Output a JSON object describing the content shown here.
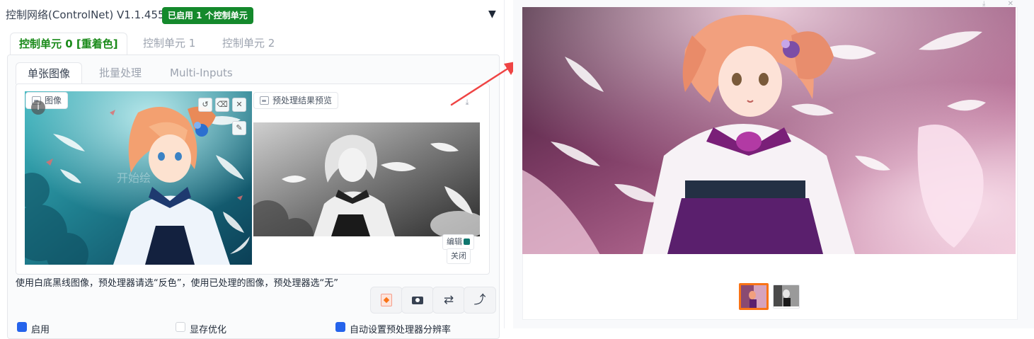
{
  "header": {
    "title": "控制网络(ControlNet) V1.1.455",
    "enabled_badge": "已启用 1 个控制单元",
    "collapse_icon": "triangle-down-icon"
  },
  "unit_tabs": [
    {
      "label": "控制单元 0 [重着色]",
      "active": true
    },
    {
      "label": "控制单元 1",
      "active": false
    },
    {
      "label": "控制单元 2",
      "active": false
    }
  ],
  "image_tabs": [
    {
      "label": "单张图像",
      "active": true
    },
    {
      "label": "批量处理",
      "active": false
    },
    {
      "label": "Multi-Inputs",
      "active": false
    }
  ],
  "image_panel": {
    "input_label": "图像",
    "watermark_text": "开始绘",
    "preview_label": "预处理结果预览",
    "edit_button": "编辑",
    "close_button": "关闭",
    "input_tools": [
      "undo-icon",
      "eraser-icon",
      "close-icon",
      "brush-icon"
    ],
    "download_icon": "download-icon"
  },
  "hint": "使用白底黑线图像，预处理器请选“反色”，使用已处理的图像，预处理器选“无”",
  "action_buttons": [
    "edit-icon",
    "camera-icon",
    "swap-icon",
    "arrow-up-right-icon"
  ],
  "options": [
    {
      "label": "启用",
      "checked": true
    },
    {
      "label": "显存优化",
      "checked": false
    },
    {
      "label": "自动设置预处理器分辨率",
      "checked": true
    }
  ],
  "output": {
    "top_icons": "⤓ ✕",
    "selected_thumbnail": 0,
    "thumbnails": [
      "color-output-thumbnail",
      "grayscale-preview-thumbnail"
    ]
  },
  "colors": {
    "accent_green": "#1a8a1a",
    "badge_green": "#14892c",
    "checkbox_blue": "#2563eb",
    "thumb_border": "#f97316",
    "arrow_red": "#ef4444"
  }
}
